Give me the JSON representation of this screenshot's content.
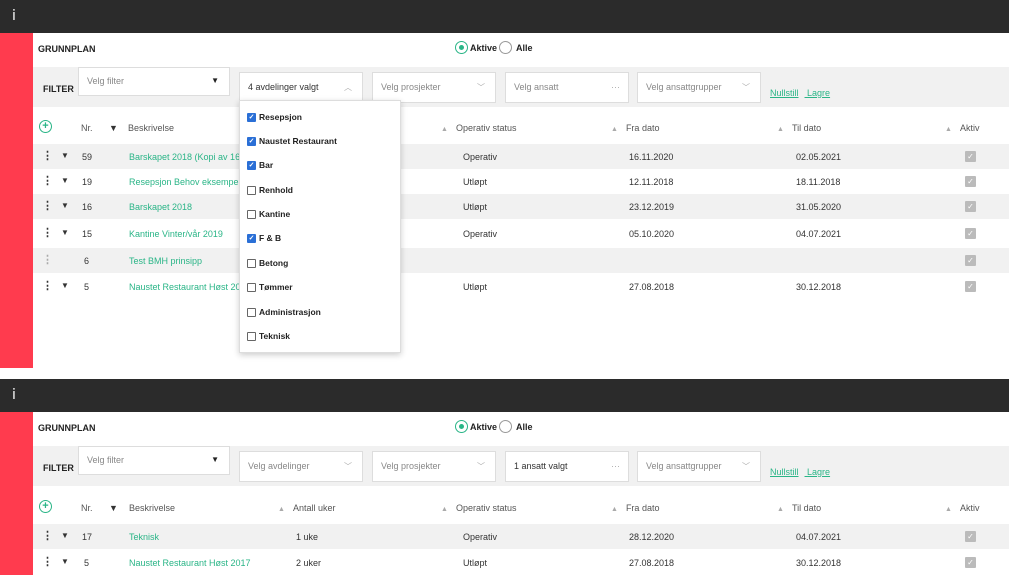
{
  "info_glyph": "i",
  "panel1": {
    "title": "GRUNNPLAN",
    "radio_active": "Aktive",
    "radio_all": "Alle",
    "filter_label": "FILTER",
    "filter_select": "Velg filter",
    "dept_select": "4 avdelinger valgt",
    "project_select": "Velg prosjekter",
    "employee_select": "Velg ansatt",
    "group_select": "Velg ansattgrupper",
    "reset_link": "Nullstill",
    "save_link": "Lagre",
    "headers": {
      "nr": "Nr.",
      "desc": "Beskrivelse",
      "status": "Operativ status",
      "from": "Fra dato",
      "to": "Til dato",
      "active": "Aktiv"
    },
    "rows": [
      {
        "nr": "59",
        "desc": "Barskapet 2018 (Kopi av 16",
        "status": "Operativ",
        "from": "16.11.2020",
        "to": "02.05.2021"
      },
      {
        "nr": "19",
        "desc": "Resepsjon Behov eksempel",
        "status": "Utløpt",
        "from": "12.11.2018",
        "to": "18.11.2018"
      },
      {
        "nr": "16",
        "desc": "Barskapet 2018",
        "status": "Utløpt",
        "from": "23.12.2019",
        "to": "31.05.2020"
      },
      {
        "nr": "15",
        "desc": "Kantine Vinter/vår 2019",
        "status": "Operativ",
        "from": "05.10.2020",
        "to": "04.07.2021"
      },
      {
        "nr": "6",
        "desc": "Test BMH prinsipp",
        "status": "",
        "from": "",
        "to": ""
      },
      {
        "nr": "5",
        "desc": "Naustet Restaurant Høst 20",
        "status": "Utløpt",
        "from": "27.08.2018",
        "to": "30.12.2018"
      }
    ],
    "dropdown_options": [
      {
        "label": "Resepsjon",
        "checked": true
      },
      {
        "label": "Naustet Restaurant",
        "checked": true
      },
      {
        "label": "Bar",
        "checked": true
      },
      {
        "label": "Renhold",
        "checked": false
      },
      {
        "label": "Kantine",
        "checked": false
      },
      {
        "label": "F & B",
        "checked": true
      },
      {
        "label": "Betong",
        "checked": false
      },
      {
        "label": "Tømmer",
        "checked": false
      },
      {
        "label": "Administrasjon",
        "checked": false
      },
      {
        "label": "Teknisk",
        "checked": false
      }
    ]
  },
  "panel2": {
    "title": "GRUNNPLAN",
    "radio_active": "Aktive",
    "radio_all": "Alle",
    "filter_label": "FILTER",
    "filter_select": "Velg filter",
    "dept_select": "Velg avdelinger",
    "project_select": "Velg prosjekter",
    "employee_select": "1 ansatt valgt",
    "group_select": "Velg ansattgrupper",
    "reset_link": "Nullstill",
    "save_link": "Lagre",
    "headers": {
      "nr": "Nr.",
      "desc": "Beskrivelse",
      "weeks": "Antall uker",
      "status": "Operativ status",
      "from": "Fra dato",
      "to": "Til dato",
      "active": "Aktiv"
    },
    "rows": [
      {
        "nr": "17",
        "desc": "Teknisk",
        "weeks": "1 uke",
        "status": "Operativ",
        "from": "28.12.2020",
        "to": "04.07.2021"
      },
      {
        "nr": "5",
        "desc": "Naustet Restaurant Høst 2017",
        "weeks": "2 uker",
        "status": "Utløpt",
        "from": "27.08.2018",
        "to": "30.12.2018"
      }
    ]
  },
  "colors": {
    "accent": "#2ab587",
    "sidebar": "#ff3b4e",
    "topbar": "#2b2b2b",
    "checkbox": "#2a6fd6"
  }
}
